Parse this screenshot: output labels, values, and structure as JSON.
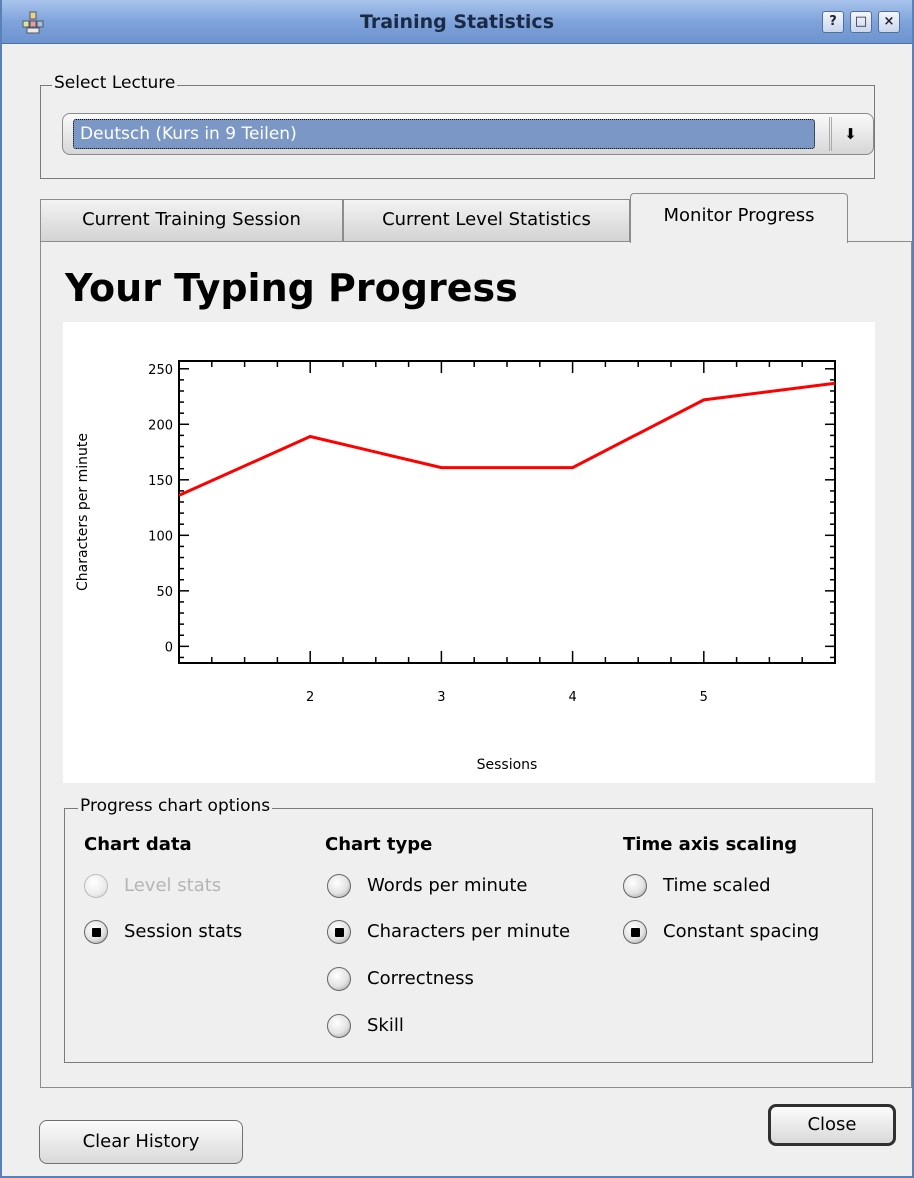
{
  "window": {
    "title": "Training Statistics",
    "help_label": "?",
    "maximize_label": "□",
    "close_label": "×"
  },
  "lecture": {
    "group_label": "Select Lecture",
    "selected": "Deutsch (Kurs in 9 Teilen)",
    "arrow": "⬇"
  },
  "tabs": [
    {
      "label": "Current Training Session"
    },
    {
      "label": "Current Level Statistics"
    },
    {
      "label": "Monitor Progress",
      "active": true
    }
  ],
  "heading": "Your Typing Progress",
  "chart_data": {
    "type": "line",
    "title": "",
    "xlabel": "Sessions",
    "ylabel": "Characters per minute",
    "x": [
      1,
      2,
      3,
      4,
      5,
      6
    ],
    "series": [
      {
        "values": [
          136,
          189,
          161,
          161,
          222,
          237
        ],
        "color": "#ff0000"
      }
    ],
    "xlim": [
      1,
      6
    ],
    "ylim": [
      -15,
      257
    ],
    "xticks": [
      2,
      3,
      4,
      5
    ],
    "yticks": [
      0,
      50,
      100,
      150,
      200,
      250
    ],
    "grid": false
  },
  "options": {
    "group_label": "Progress chart options",
    "chart_data_head": "Chart data",
    "chart_type_head": "Chart type",
    "time_axis_head": "Time axis scaling",
    "chart_data_items": [
      {
        "label": "Level stats",
        "checked": false,
        "disabled": true
      },
      {
        "label": "Session stats",
        "checked": true,
        "disabled": false
      }
    ],
    "chart_type_items": [
      {
        "label": "Words per minute",
        "checked": false
      },
      {
        "label": "Characters per minute",
        "checked": true
      },
      {
        "label": "Correctness",
        "checked": false
      },
      {
        "label": "Skill",
        "checked": false
      }
    ],
    "time_axis_items": [
      {
        "label": "Time scaled",
        "checked": false
      },
      {
        "label": "Constant spacing",
        "checked": true
      }
    ]
  },
  "buttons": {
    "clear_history": "Clear History",
    "close": "Close"
  }
}
